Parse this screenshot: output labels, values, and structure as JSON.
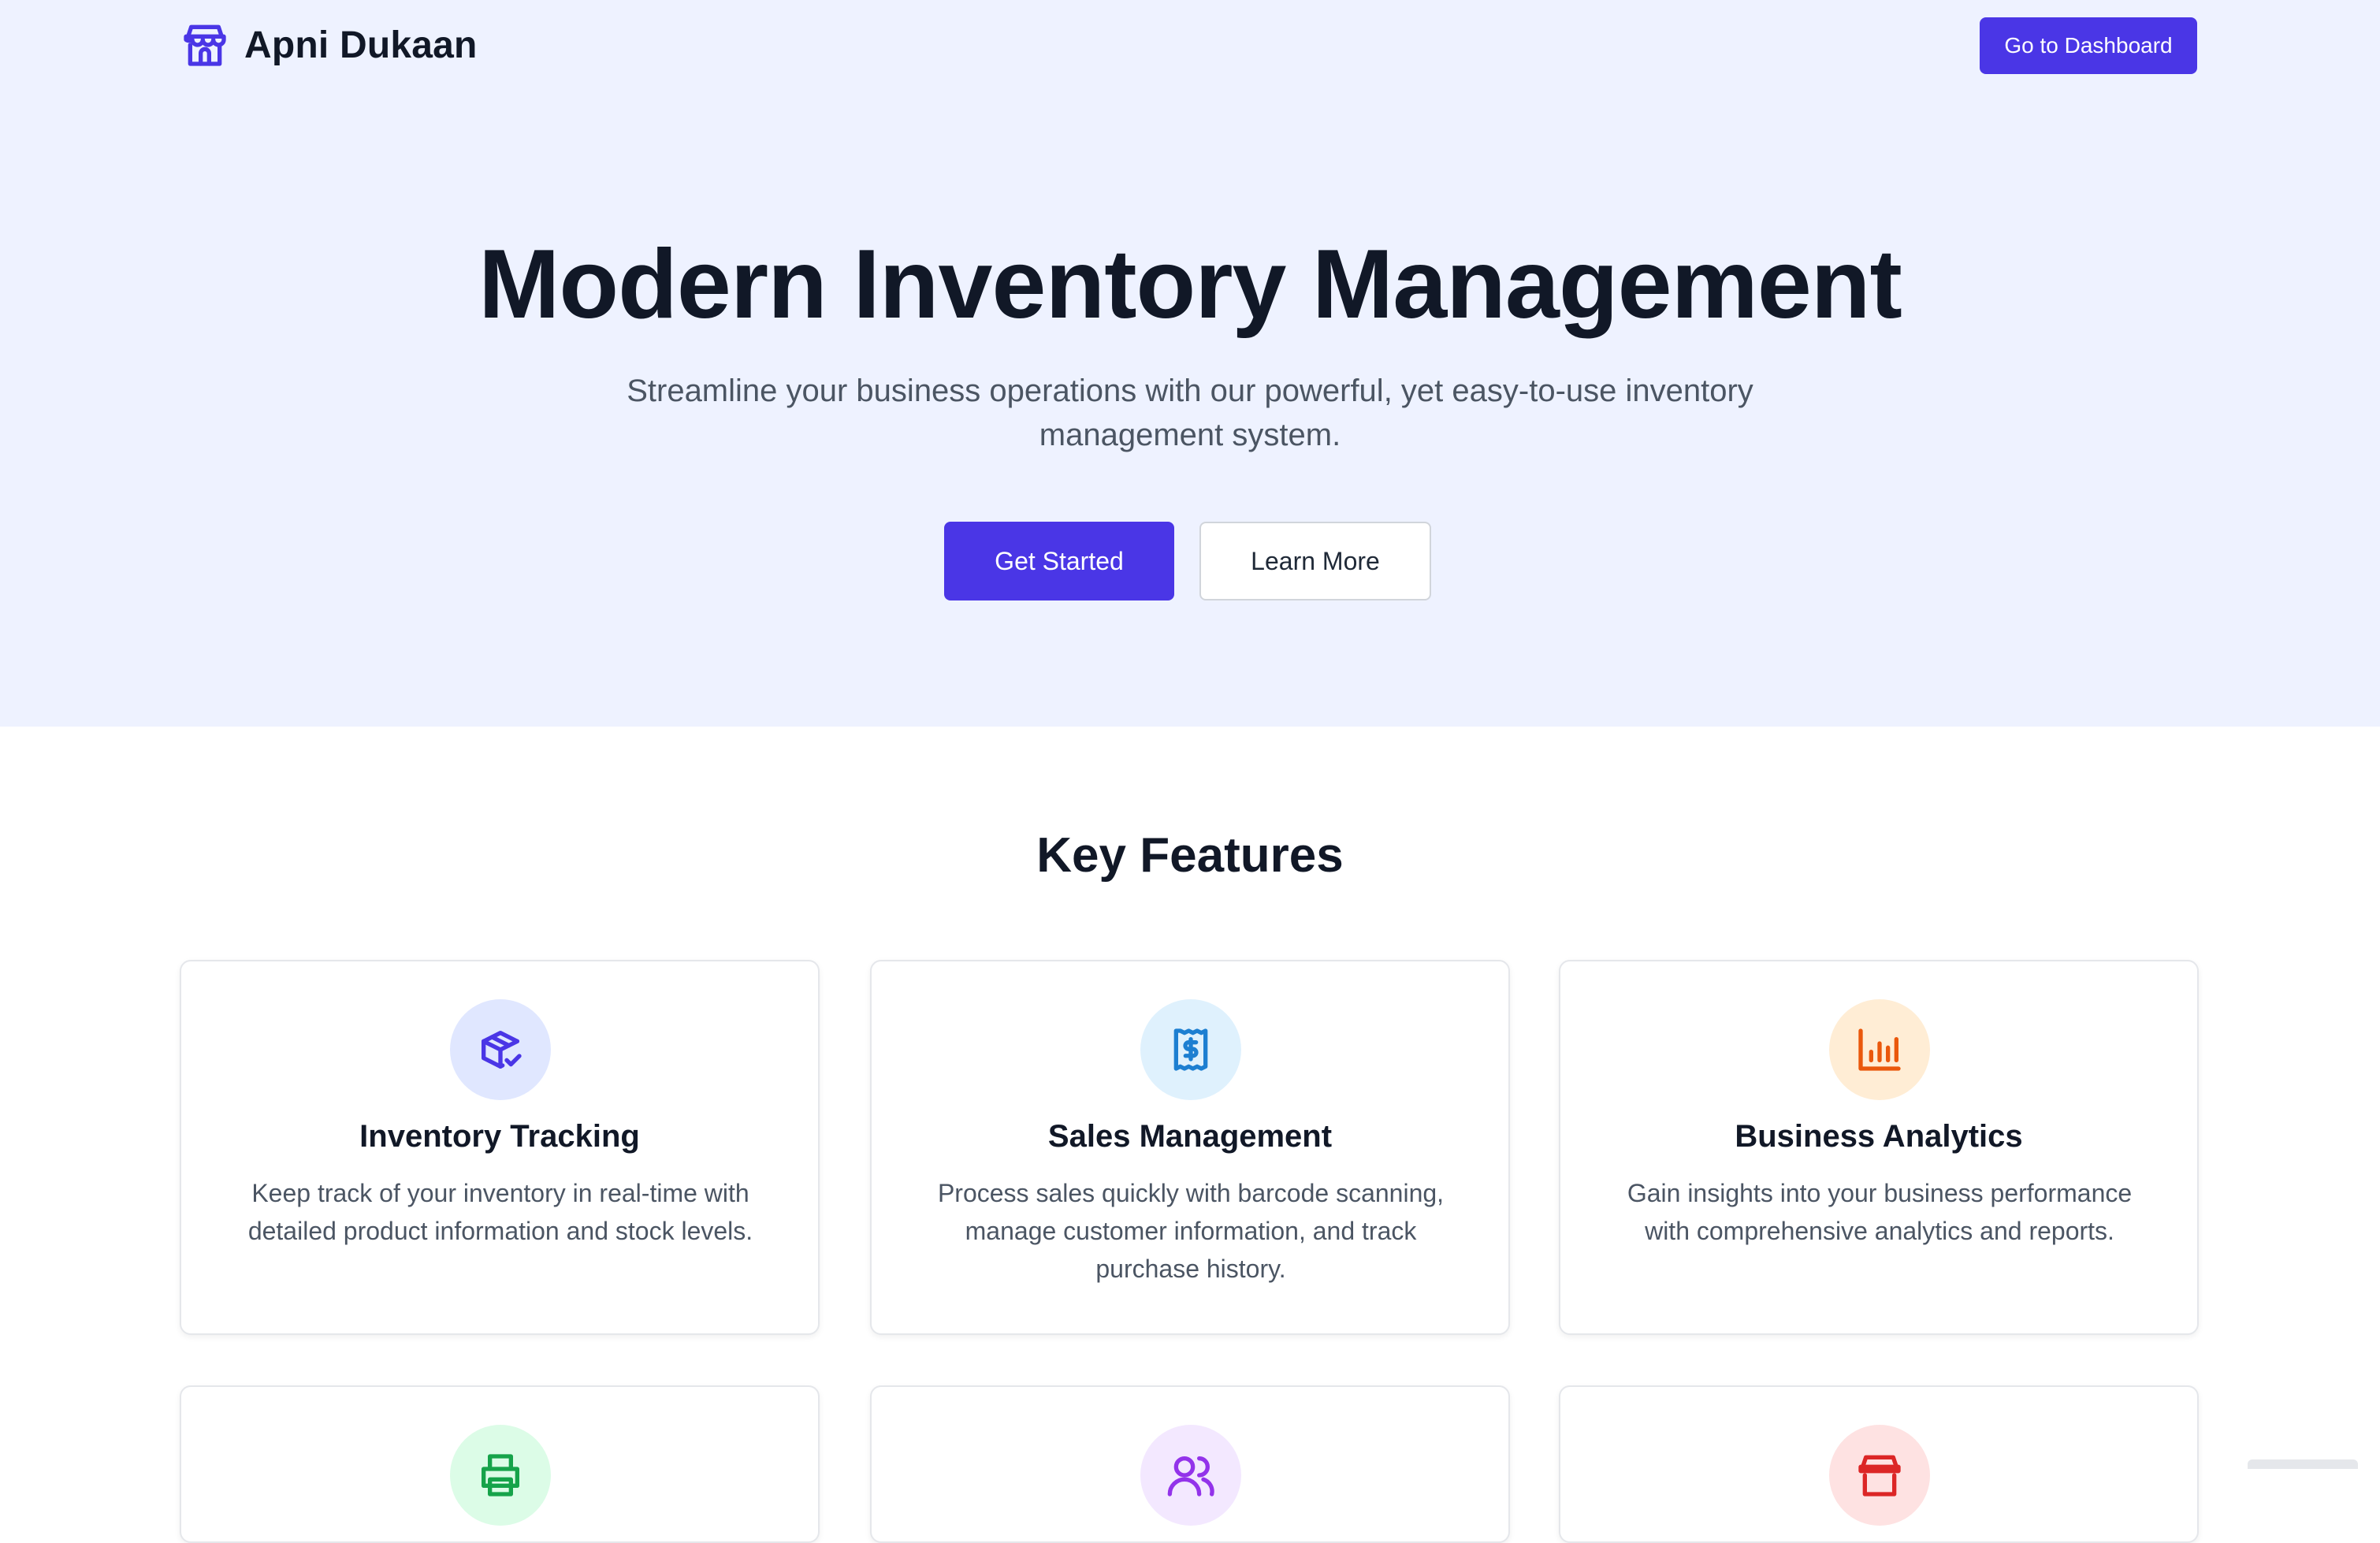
{
  "nav": {
    "brand_name": "Apni Dukaan",
    "brand_icon": "store-icon",
    "dashboard_button": "Go to Dashboard"
  },
  "hero": {
    "title": "Modern Inventory Management",
    "subtitle": "Streamline your business operations with our powerful, yet easy-to-use inventory management system.",
    "primary_cta": "Get Started",
    "secondary_cta": "Learn More"
  },
  "features": {
    "title": "Key Features",
    "items": [
      {
        "title": "Inventory Tracking",
        "description": "Keep track of your inventory in real-time with detailed product information and stock levels.",
        "icon": "package-check-icon",
        "icon_color": "#4a36e6",
        "icon_bg": "#e0e7ff"
      },
      {
        "title": "Sales Management",
        "description": "Process sales quickly with barcode scanning, manage customer information, and track purchase history.",
        "icon": "receipt-dollar-icon",
        "icon_color": "#1d7fd1",
        "icon_bg": "#dff1fd"
      },
      {
        "title": "Business Analytics",
        "description": "Gain insights into your business performance with comprehensive analytics and reports.",
        "icon": "bar-chart-icon",
        "icon_color": "#ea580c",
        "icon_bg": "#ffedd5"
      },
      {
        "title": "",
        "description": "",
        "icon": "printer-icon",
        "icon_color": "#16a34a",
        "icon_bg": "#dcfce7"
      },
      {
        "title": "",
        "description": "",
        "icon": "users-icon",
        "icon_color": "#9333ea",
        "icon_bg": "#f3e8ff"
      },
      {
        "title": "",
        "description": "",
        "icon": "store-icon",
        "icon_color": "#dc2626",
        "icon_bg": "#fee2e2"
      }
    ]
  },
  "colors": {
    "accent": "#4a36e6",
    "hero_bg": "#eef2ff",
    "text_dark": "#111827",
    "text_muted": "#4b5563"
  }
}
